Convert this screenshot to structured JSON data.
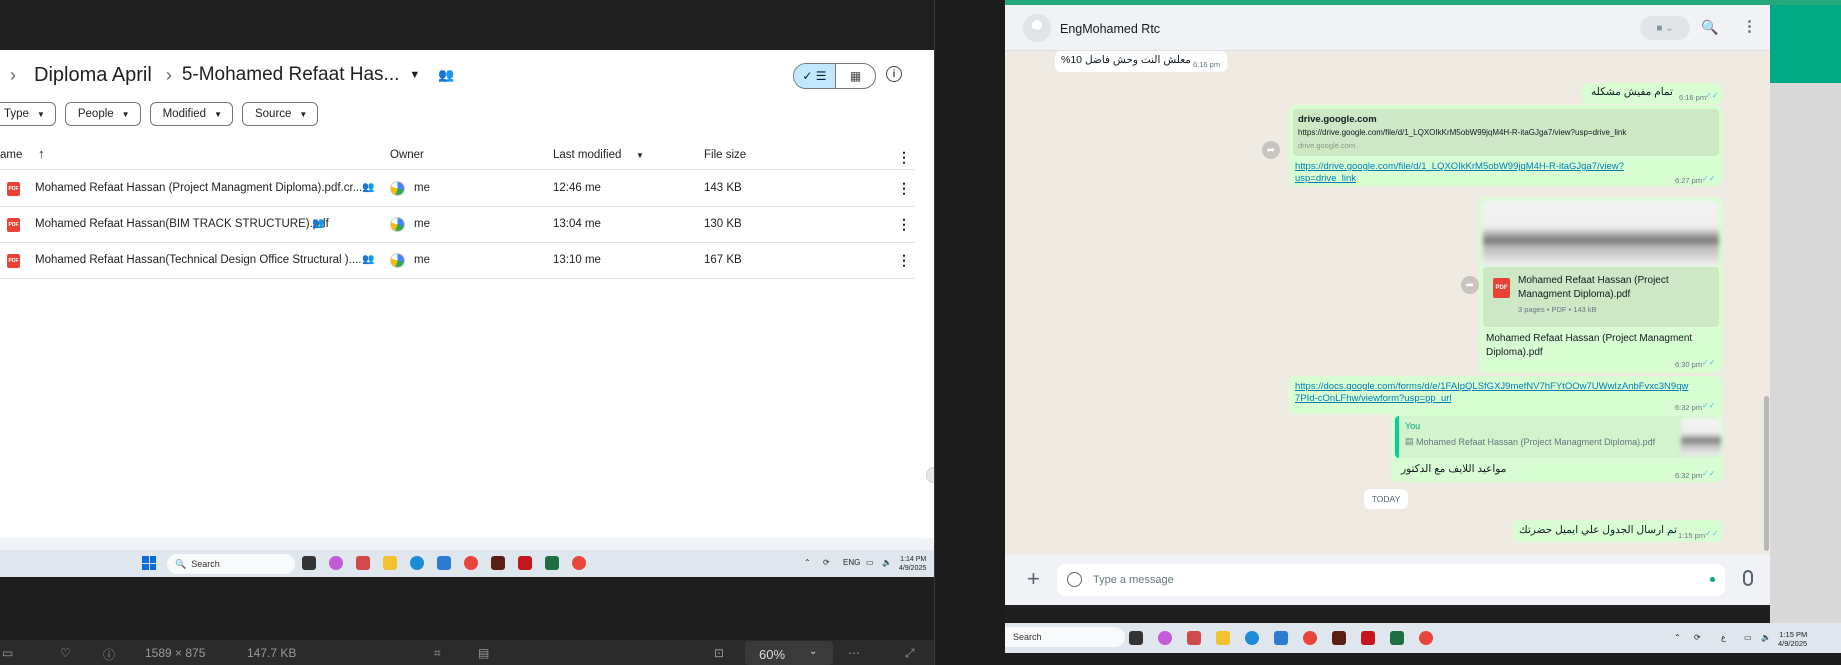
{
  "drive": {
    "breadcrumb": {
      "parent": "Diploma April",
      "current": "5-Mohamed Refaat Has..."
    },
    "filters": [
      "Type",
      "People",
      "Modified",
      "Source"
    ],
    "columns": {
      "name": "ame",
      "owner": "Owner",
      "modified": "Last modified",
      "size": "File size"
    },
    "files": [
      {
        "name": "Mohamed Refaat Hassan  (Project Managment Diploma).pdf.cr...",
        "owner": "me",
        "modified": "12:46 me",
        "size": "143 KB"
      },
      {
        "name": "Mohamed Refaat Hassan(BIM TRACK STRUCTURE).pdf",
        "owner": "me",
        "modified": "13:04 me",
        "size": "130 KB"
      },
      {
        "name": "Mohamed Refaat Hassan(Technical Design Office Structural )....",
        "owner": "me",
        "modified": "13:10 me",
        "size": "167 KB"
      }
    ]
  },
  "taskbar_left": {
    "search": "Search",
    "lang": "ENG",
    "time": "1:14 PM",
    "date": "4/9/2025"
  },
  "viewer": {
    "dims": "1589 × 875",
    "size": "147.7 KB",
    "zoom": "60%"
  },
  "whatsapp": {
    "contact": "EngMohamed Rtc",
    "messages": {
      "m1": {
        "text": "معلش النت وحش فاضل 10%",
        "time": "6:16 pm"
      },
      "m2": {
        "text": "تمام مفيش مشكله",
        "time": "6:16 pm"
      },
      "m3": {
        "preview_title": "drive.google.com",
        "preview_url": "https://drive.google.com/file/d/1_LQXOIkKrM5obW99jqM4H-R-itaGJga7/view?usp=drive_link",
        "preview_domain": "drive.google.com",
        "link_line1": "https://drive.google.com/file/d/1_LQXOIkKrM5obW99jqM4H-R-itaGJga7/view?",
        "link_line2": "usp=drive_link",
        "time": "6:27 pm"
      },
      "m4": {
        "file_name_line1": "Mohamed Refaat Hassan  (Project",
        "file_name_line2": "Managment Diploma).pdf",
        "file_meta": "3 pages • PDF • 143 kB",
        "caption_line1": "Mohamed Refaat Hassan  (Project Managment",
        "caption_line2": "Diploma).pdf",
        "time": "6:30 pm"
      },
      "m5": {
        "link_line1": "https://docs.google.com/forms/d/e/1FAIpQLSfGXJ9mefNV7hFYtOOw7UWwIzAnbFvxc3N9qw",
        "link_line2": "7PId-cOnLFhw/viewform?usp=pp_url",
        "time": "6:32 pm"
      },
      "m6": {
        "quote_author": "You",
        "quote_text": "Mohamed Refaat Hassan  (Project Managment Diploma).pdf",
        "text": "مواعيد اللايف مع الدكتور",
        "time": "6:32 pm"
      },
      "date_chip": "TODAY",
      "m7": {
        "text": "تم ارسال الجدول علي ايميل حضرتك",
        "time": "1:15 pm"
      }
    },
    "input_placeholder": "Type a message"
  },
  "taskbar_right": {
    "search": "Search",
    "lang": "ع",
    "time": "1:15 PM",
    "date": "4/9/2025"
  }
}
